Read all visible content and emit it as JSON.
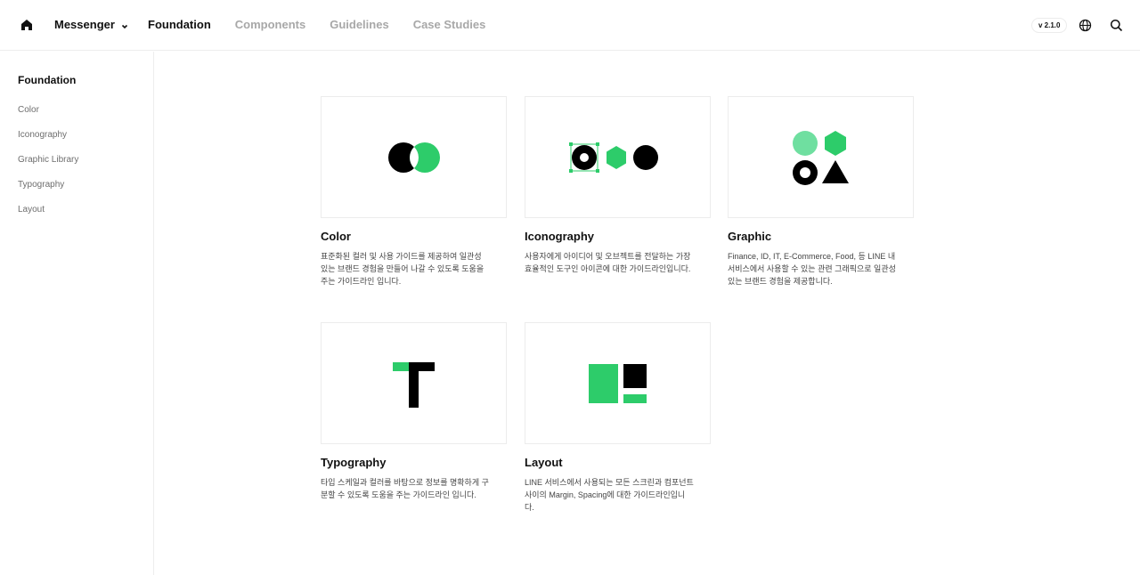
{
  "header": {
    "product": "Messenger",
    "nav": [
      "Foundation",
      "Components",
      "Guidelines",
      "Case Studies"
    ],
    "active_nav": "Foundation",
    "version": "v 2.1.0",
    "icons": [
      "home-icon",
      "chevron-down-icon",
      "globe-icon",
      "search-icon"
    ]
  },
  "sidebar": {
    "title": "Foundation",
    "items": [
      "Color",
      "Iconography",
      "Graphic Library",
      "Typography",
      "Layout"
    ]
  },
  "colors": {
    "brand_green": "#2dcc6a",
    "light_green": "#6fdfa0",
    "black": "#000000"
  },
  "cards": [
    {
      "title": "Color",
      "desc": "표준화된 컬러 및 사용 가이드를 제공하여 일관성 있는 브랜드 경험을 만들어 나갈 수 있도록 도움을 주는 가이드라인 입니다."
    },
    {
      "title": "Iconography",
      "desc": "사용자에게 아이디어 및 오브젝트를 전달하는 가장 효율적인 도구인 아이콘에 대한 가이드라인입니다."
    },
    {
      "title": "Graphic",
      "desc": "Finance, ID, IT, E-Commerce, Food, 등 LINE 내 서비스에서 사용할 수 있는 관련 그래픽으로 일관성 있는 브랜드 경험을 제공합니다."
    },
    {
      "title": "Typography",
      "desc": "타입 스케일과 컬러를 바탕으로 정보를 명확하게 구분할 수 있도록 도움을 주는 가이드라인 입니다."
    },
    {
      "title": "Layout",
      "desc": "LINE 서비스에서 사용되는 모든 스크린과 컴포넌트 사이의 Margin, Spacing에 대한 가이드라인입니다."
    }
  ]
}
